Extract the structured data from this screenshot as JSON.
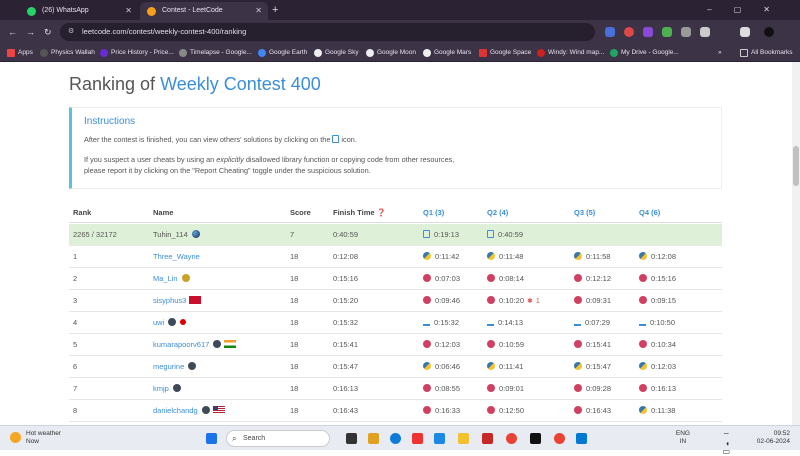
{
  "browser": {
    "tabs": [
      {
        "label": "(26) WhatsApp",
        "active": false
      },
      {
        "label": "Contest - LeetCode",
        "active": true
      }
    ],
    "url": "leetcode.com/contest/weekly-contest-400/ranking",
    "bookmarks": [
      "Apps",
      "Physics Wallah",
      "Price History - Price...",
      "Timelapse - Google...",
      "Google Earth",
      "Google Sky",
      "Google Moon",
      "Google Mars",
      "Google Space",
      "Windy: Wind map...",
      "My Drive - Google..."
    ],
    "all_bookmarks": "All Bookmarks"
  },
  "page": {
    "title_prefix": "Ranking of ",
    "title_link": "Weekly Contest 400",
    "instructions": {
      "heading": "Instructions",
      "line1_a": "After the contest is finished, you can view others' solutions by clicking on the ",
      "line1_b": " icon.",
      "line2_a": "If you suspect a user cheats by using an ",
      "line2_em": "explicitly",
      "line2_b": " disallowed library function or copying code from other resources,",
      "line3": "please report it by clicking on the \"Report Cheating\" toggle under the suspicious solution."
    },
    "table": {
      "headers": {
        "rank": "Rank",
        "name": "Name",
        "score": "Score",
        "finish": "Finish Time",
        "q1": "Q1 (3)",
        "q2": "Q2 (4)",
        "q3": "Q3 (5)",
        "q4": "Q4 (6)"
      },
      "rows": [
        {
          "rank": "2265 / 32172",
          "name": "Tuhin_114",
          "score": "7",
          "finish": "0:40:59",
          "q1": "0:19:13",
          "q2": "0:40:59",
          "q3": "",
          "q4": ""
        },
        {
          "rank": "1",
          "name": "Three_Wayne",
          "score": "18",
          "finish": "0:12:08",
          "q1": "0:11:42",
          "q2": "0:11:48",
          "q3": "0:11:58",
          "q4": "0:12:08"
        },
        {
          "rank": "2",
          "name": "Ma_Lin",
          "score": "18",
          "finish": "0:15:16",
          "q1": "0:07:03",
          "q2": "0:08:14",
          "q3": "0:12:12",
          "q4": "0:15:16"
        },
        {
          "rank": "3",
          "name": "sisyphus3",
          "score": "18",
          "finish": "0:15:20",
          "q1": "0:09:46",
          "q2": "0:10:20",
          "q2_wrong": "1",
          "q3": "0:09:31",
          "q4": "0:09:15"
        },
        {
          "rank": "4",
          "name": "uwi",
          "score": "18",
          "finish": "0:15:32",
          "q1": "0:15:32",
          "q2": "0:14:13",
          "q3": "0:07:29",
          "q4": "0:10:50"
        },
        {
          "rank": "5",
          "name": "kumarapoorv617",
          "score": "18",
          "finish": "0:15:41",
          "q1": "0:12:03",
          "q2": "0:10:59",
          "q3": "0:15:41",
          "q4": "0:10:34"
        },
        {
          "rank": "6",
          "name": "megurine",
          "score": "18",
          "finish": "0:15:47",
          "q1": "0:06:46",
          "q2": "0:11:41",
          "q3": "0:15:47",
          "q4": "0:12:03"
        },
        {
          "rank": "7",
          "name": "kmjp",
          "score": "18",
          "finish": "0:16:13",
          "q1": "0:08:55",
          "q2": "0:09:01",
          "q3": "0:09:28",
          "q4": "0:16:13"
        },
        {
          "rank": "8",
          "name": "danielchandg",
          "score": "18",
          "finish": "0:16:43",
          "q1": "0:16:33",
          "q2": "0:12:50",
          "q3": "0:16:43",
          "q4": "0:11:38"
        }
      ]
    }
  },
  "taskbar": {
    "weather_title": "Hot weather",
    "weather_sub": "Now",
    "search_placeholder": "Search",
    "lang_top": "ENG",
    "lang_bottom": "IN",
    "time": "09:52",
    "date": "02-06-2024"
  },
  "colors": {
    "accent": "#3a8edb",
    "highlight_row": "#dff0d8",
    "chrome_dark": "#2b2233"
  }
}
